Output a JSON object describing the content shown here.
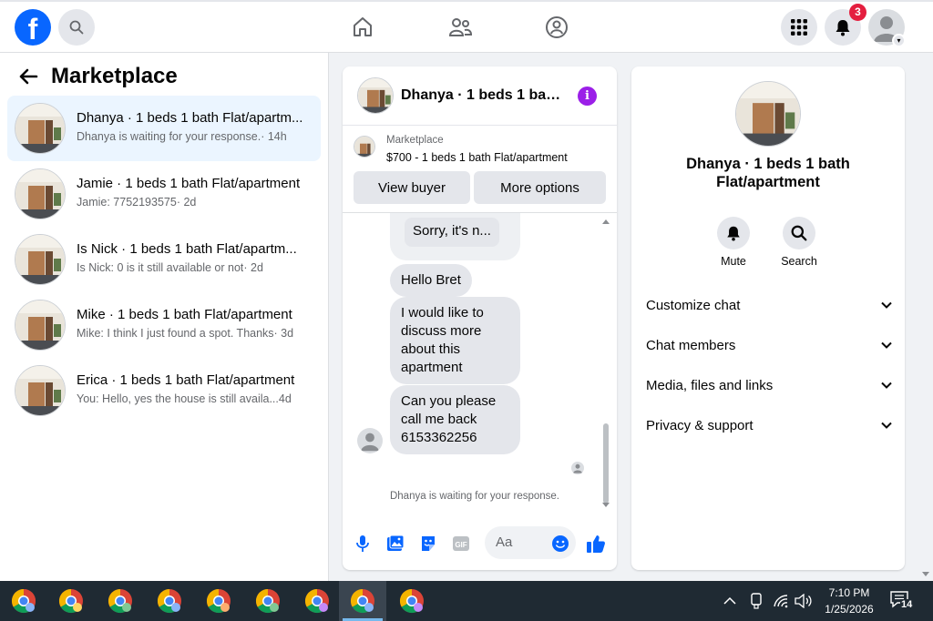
{
  "topbar": {
    "logo_letter": "f",
    "notifications_badge": "3",
    "icons": [
      "search-icon",
      "home-icon",
      "friends-icon",
      "groups-icon",
      "menu-grid-icon",
      "bell-icon",
      "profile-avatar"
    ]
  },
  "left": {
    "title": "Marketplace",
    "conversations": [
      {
        "title": "Dhanya · 1 beds 1 bath Flat/apartm...",
        "snippet": "Dhanya is waiting for your response.",
        "time": "· 14h",
        "active": true
      },
      {
        "title": "Jamie · 1 beds 1 bath Flat/apartment",
        "snippet": "Jamie: 7752193575",
        "time": "· 2d",
        "active": false
      },
      {
        "title": "Is Nick · 1 beds 1 bath Flat/apartm...",
        "snippet": "Is Nick: 0 is it still available or not",
        "time": "· 2d",
        "active": false
      },
      {
        "title": "Mike · 1 beds 1 bath Flat/apartment",
        "snippet": "Mike: I think I just found a spot. Thanks",
        "time": "· 3d",
        "active": false
      },
      {
        "title": "Erica · 1 beds 1 bath Flat/apartment",
        "snippet": "You: Hello, yes the house is still availa...",
        "time": " 4d",
        "active": false
      }
    ]
  },
  "chat": {
    "header_title": "Dhanya · 1 beds 1 bat···",
    "listing_label": "Marketplace",
    "listing_price": "$700 - 1 beds 1 bath Flat/apartment",
    "view_buyer_label": "View buyer",
    "more_options_label": "More options",
    "reply_preview": "Sorry, it's n...",
    "messages": [
      "Hello Bret",
      "I would like to discuss more about this apartment",
      "Can you please call me back 6153362256"
    ],
    "waiting_note": "Dhanya is waiting for your response.",
    "composer_placeholder": "Aa"
  },
  "details": {
    "title": "Dhanya · 1 beds 1 bath Flat/apartment",
    "mute_label": "Mute",
    "search_label": "Search",
    "sections": [
      "Customize chat",
      "Chat members",
      "Media, files and links",
      "Privacy & support"
    ]
  },
  "taskbar": {
    "time": "7:10 PM",
    "date": "1/25/2026",
    "notification_count": "14",
    "app_count": 9
  },
  "colors": {
    "accent": "#0866ff",
    "badge": "#e41e3f",
    "info": "#9b1fe8",
    "active_row": "#ebf5ff"
  }
}
